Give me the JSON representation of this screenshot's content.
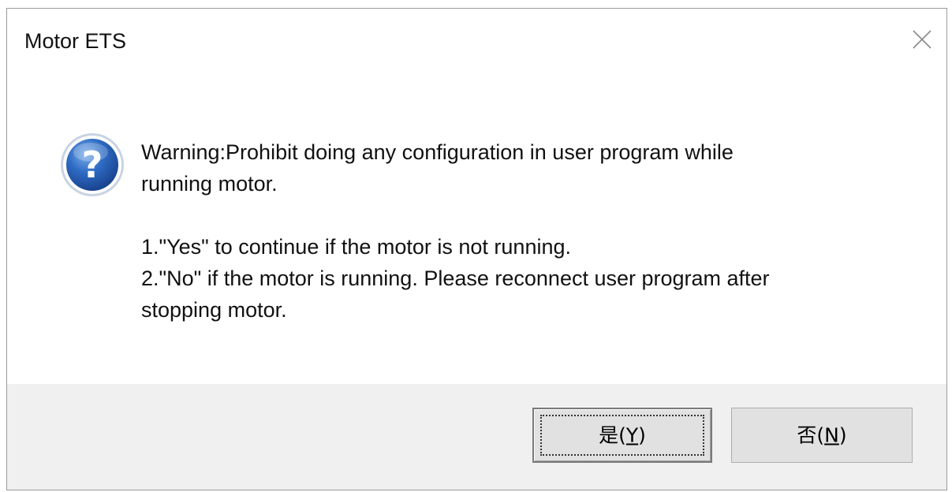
{
  "window": {
    "title": "Motor ETS",
    "close_icon": "close-icon"
  },
  "message": {
    "icon": "question-icon",
    "icon_glyph": "?",
    "line1": "Warning:Prohibit doing any configuration in user program while",
    "line2": "running motor.",
    "line3": "1.\"Yes\" to continue if the motor is not running.",
    "line4": "2.\"No\" if the motor is running. Please reconnect user program after",
    "line5": "stopping motor."
  },
  "buttons": {
    "yes": {
      "prefix": "是(",
      "mnemonic": "Y",
      "suffix": ")"
    },
    "no": {
      "prefix": "否(",
      "mnemonic": "N",
      "suffix": ")"
    }
  },
  "colors": {
    "footer_background": "#f0f0f0",
    "button_face": "#e1e1e1",
    "icon_blue": "#1f54a8"
  }
}
